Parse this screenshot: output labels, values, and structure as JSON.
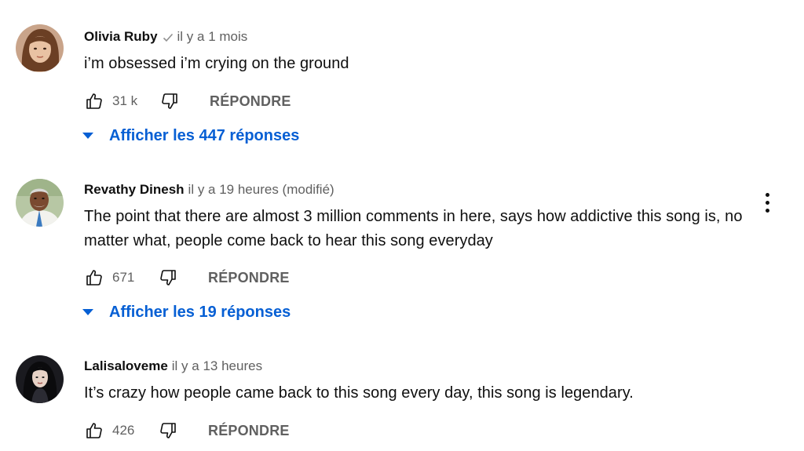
{
  "comments": [
    {
      "author": "Olivia Ruby",
      "verified": true,
      "time": "il y a 1 mois",
      "text": "i’m obsessed i’m crying on the ground",
      "likes": "31 k",
      "reply_label": "RÉPONDRE",
      "replies_label": "Afficher les 447 réponses",
      "avatar_icon": "avatar-photo"
    },
    {
      "author": "Revathy Dinesh",
      "verified": false,
      "time": "il y a 19 heures (modifié)",
      "text": "The point that there are almost 3 million comments in here, says how addictive this song is, no matter what, people come back to hear this song everyday",
      "likes": "671",
      "reply_label": "RÉPONDRE",
      "replies_label": "Afficher les 19 réponses",
      "avatar_icon": "avatar-photo"
    },
    {
      "author": "Lalisaloveme",
      "verified": false,
      "time": "il y a 13 heures",
      "text": "It’s crazy how people came back to this song every day, this song is legendary.",
      "likes": "426",
      "reply_label": "RÉPONDRE",
      "avatar_icon": "avatar-photo"
    }
  ],
  "colors": {
    "link_blue": "#065fd4",
    "secondary_text": "#606060",
    "primary_text": "#0f0f0f"
  },
  "icons": [
    "thumbs-up-icon",
    "thumbs-down-icon",
    "check-icon",
    "caret-down-icon",
    "more-vert-icon"
  ]
}
